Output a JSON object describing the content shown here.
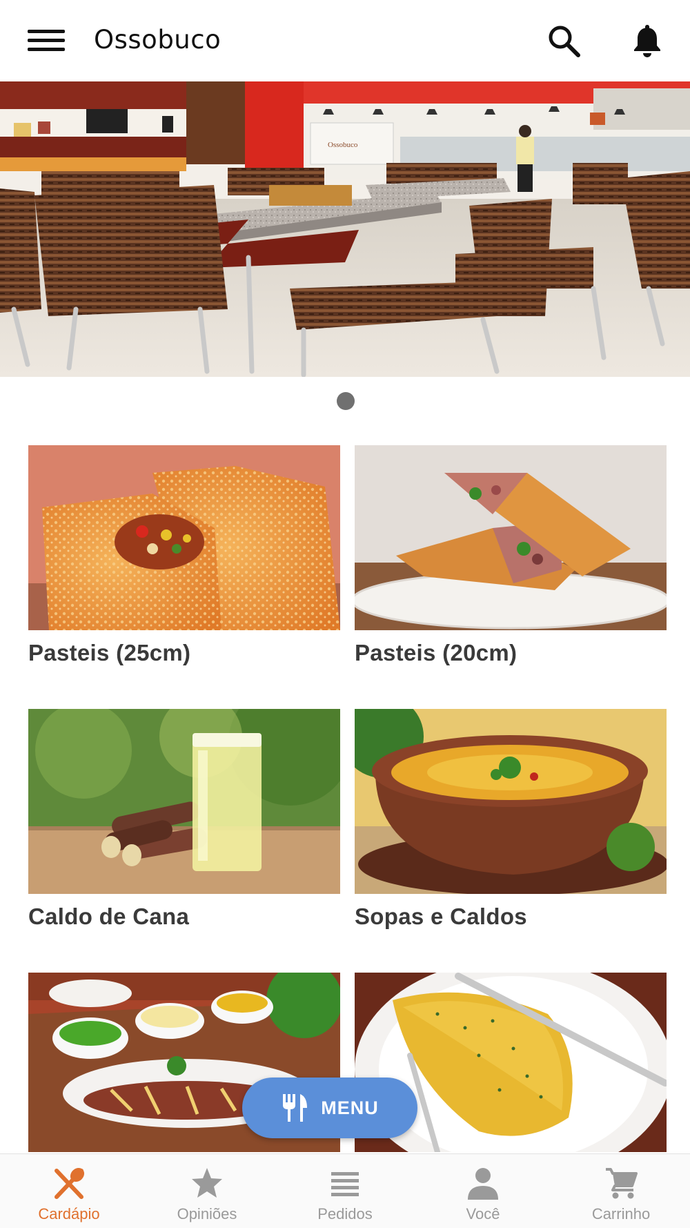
{
  "header": {
    "title": "Ossobuco",
    "menu_icon": "hamburger-menu-icon",
    "search_icon": "search-icon",
    "notifications_icon": "bell-icon"
  },
  "hero": {
    "sign_text": "Ossobuco",
    "slide_count": 1,
    "active_slide": 1
  },
  "categories": [
    {
      "label": "Pasteis (25cm)"
    },
    {
      "label": "Pasteis (20cm)"
    },
    {
      "label": "Caldo de Cana"
    },
    {
      "label": "Sopas e Caldos"
    },
    {
      "label": ""
    },
    {
      "label": ""
    }
  ],
  "fab": {
    "label": "MENU",
    "icon": "fork-knife-icon",
    "color": "#5b8fd9"
  },
  "bottom_nav": {
    "active_color": "#e0712e",
    "inactive_color": "#9a9a9a",
    "items": [
      {
        "label": "Cardápio",
        "icon": "utensils-icon",
        "active": true
      },
      {
        "label": "Opiniões",
        "icon": "star-icon",
        "active": false
      },
      {
        "label": "Pedidos",
        "icon": "list-icon",
        "active": false
      },
      {
        "label": "Você",
        "icon": "person-icon",
        "active": false
      },
      {
        "label": "Carrinho",
        "icon": "cart-icon",
        "active": false
      }
    ]
  }
}
